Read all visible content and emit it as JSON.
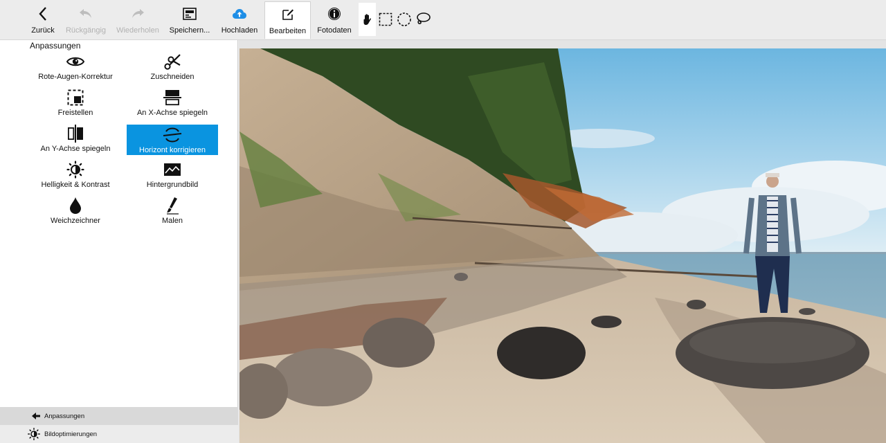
{
  "toolbar": {
    "back": "Zurück",
    "undo": "Rückgängig",
    "redo": "Wiederholen",
    "save": "Speichern...",
    "upload": "Hochladen",
    "edit": "Bearbeiten",
    "info": "Fotodaten"
  },
  "tools": [
    "hand-tool",
    "rect-select",
    "ellipse-select",
    "lasso-select"
  ],
  "panel": {
    "title": "Anpassungen",
    "items": [
      {
        "label": "Rote-Augen-Korrektur",
        "icon": "eye-icon"
      },
      {
        "label": "Zuschneiden",
        "icon": "scissors-icon"
      },
      {
        "label": "Freistellen",
        "icon": "crop-select-icon"
      },
      {
        "label": "An X-Achse spiegeln",
        "icon": "flip-x-icon"
      },
      {
        "label": "An Y-Achse spiegeln",
        "icon": "flip-y-icon"
      },
      {
        "label": "Horizont korrigieren",
        "icon": "horizon-icon",
        "selected": true
      },
      {
        "label": "Helligkeit & Kontrast",
        "icon": "brightness-icon"
      },
      {
        "label": "Hintergrundbild",
        "icon": "landscape-icon"
      },
      {
        "label": "Weichzeichner",
        "icon": "drop-icon"
      },
      {
        "label": "Malen",
        "icon": "brush-icon"
      }
    ]
  },
  "bottom_tabs": {
    "adjustments": "Anpassungen",
    "optimize": "Bildoptimierungen"
  },
  "colors": {
    "accent": "#0a94e0",
    "toolbar_bg": "#ececec",
    "upload_icon": "#1e8ee6"
  }
}
